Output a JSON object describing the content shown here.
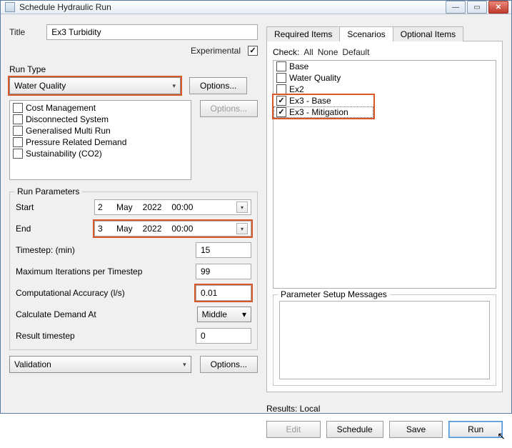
{
  "window": {
    "title": "Schedule Hydraulic Run"
  },
  "title_row": {
    "label": "Title",
    "value": "Ex3 Turbidity"
  },
  "experimental": {
    "label": "Experimental",
    "checked": true
  },
  "run_type": {
    "label": "Run Type",
    "value": "Water Quality",
    "options_btn": "Options...",
    "options_btn2": "Options...",
    "list": [
      {
        "label": "Cost Management",
        "checked": false
      },
      {
        "label": "Disconnected System",
        "checked": false
      },
      {
        "label": "Generalised Multi Run",
        "checked": false
      },
      {
        "label": "Pressure Related Demand",
        "checked": false
      },
      {
        "label": "Sustainability (CO2)",
        "checked": false
      }
    ]
  },
  "run_params": {
    "legend": "Run Parameters",
    "start": {
      "label": "Start",
      "day": "2",
      "month": "May",
      "year": "2022",
      "time": "00:00"
    },
    "end": {
      "label": "End",
      "day": "3",
      "month": "May",
      "year": "2022",
      "time": "00:00"
    },
    "timestep": {
      "label": "Timestep: (min)",
      "value": "15"
    },
    "maxiter": {
      "label": "Maximum Iterations per Timestep",
      "value": "99"
    },
    "accuracy": {
      "label": "Computational Accuracy (l/s)",
      "value": "0.01"
    },
    "calc_at": {
      "label": "Calculate Demand At",
      "value": "Middle"
    },
    "result_ts": {
      "label": "Result timestep",
      "value": "0"
    }
  },
  "validation": {
    "value": "Validation",
    "options_btn": "Options..."
  },
  "tabs": {
    "required": "Required Items",
    "scenarios": "Scenarios",
    "optional": "Optional Items"
  },
  "check_row": {
    "label": "Check:",
    "all": "All",
    "none": "None",
    "default": "Default"
  },
  "scenarios": [
    {
      "label": "Base",
      "checked": false
    },
    {
      "label": "Water Quality",
      "checked": false
    },
    {
      "label": "Ex2",
      "checked": false
    },
    {
      "label": "Ex3 - Base",
      "checked": true
    },
    {
      "label": "Ex3 - Mitigation",
      "checked": true
    }
  ],
  "psm": {
    "legend": "Parameter Setup Messages"
  },
  "results": {
    "label": "Results: Local"
  },
  "buttons": {
    "edit": "Edit",
    "schedule": "Schedule",
    "save": "Save",
    "run": "Run"
  }
}
